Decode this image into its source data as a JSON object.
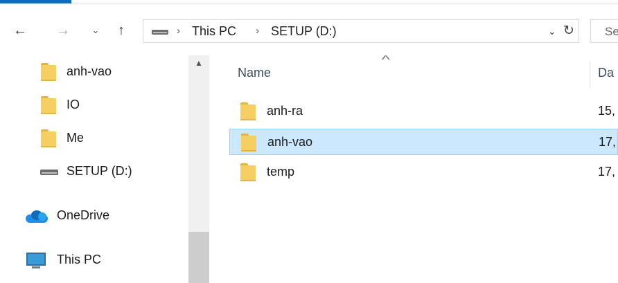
{
  "window": {
    "accent_color": "#0f6cbd"
  },
  "navigation": {
    "back_icon": "←",
    "forward_icon": "→",
    "recent_icon": "⌄",
    "up_icon": "↑"
  },
  "address_bar": {
    "breadcrumbs": [
      "This PC",
      "SETUP (D:)"
    ],
    "separator": "›",
    "dropdown_icon": "⌄",
    "refresh_icon": "↻"
  },
  "search": {
    "placeholder": "Se"
  },
  "sidebar": {
    "scroll_up_icon": "▲",
    "items": [
      {
        "label": "anh-vao",
        "icon": "folder-icon"
      },
      {
        "label": "IO",
        "icon": "folder-icon"
      },
      {
        "label": "Me",
        "icon": "folder-icon"
      },
      {
        "label": "SETUP (D:)",
        "icon": "drive-icon"
      },
      {
        "label": "OneDrive",
        "icon": "onedrive-icon"
      },
      {
        "label": "This PC",
        "icon": "this-pc-icon"
      }
    ]
  },
  "file_list": {
    "sort_icon": "^",
    "columns": {
      "name": "Name",
      "date": "Da"
    },
    "rows": [
      {
        "name": "anh-ra",
        "date": "15,",
        "selected": false
      },
      {
        "name": "anh-vao",
        "date": "17,",
        "selected": true
      },
      {
        "name": "temp",
        "date": "17,",
        "selected": false
      }
    ],
    "selection_color": "#cce8ff"
  }
}
